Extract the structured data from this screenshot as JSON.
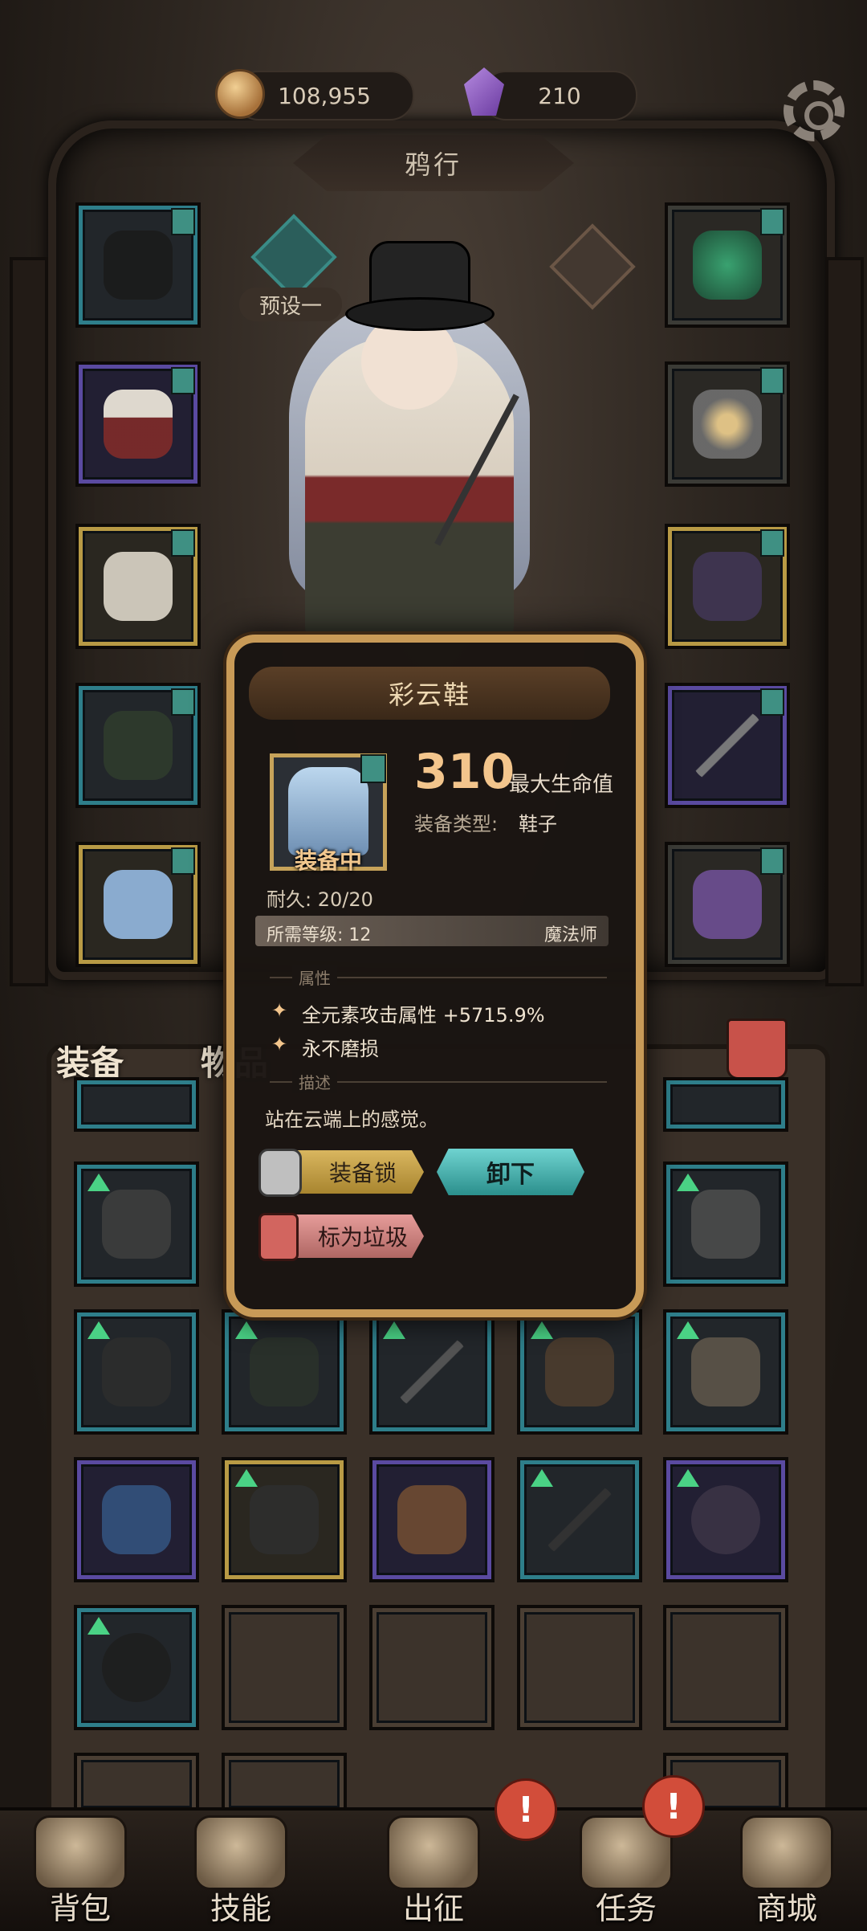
{
  "currency": {
    "gold": "108,955",
    "gems": "210"
  },
  "character": {
    "name": "鸦行",
    "preset_label": "预设一"
  },
  "tabs": {
    "equip": "装备",
    "items": "物品"
  },
  "popup": {
    "title": "彩云鞋",
    "equipped_label": "装备中",
    "stat_value": "310",
    "stat_name": "最大生命值",
    "type_label": "装备类型:",
    "type_value": "鞋子",
    "durability": "耐久: 20/20",
    "req_level": "所需等级: 12",
    "req_class": "魔法师",
    "section_attributes": "属性",
    "attributes": [
      "全元素攻击属性 +5715.9%",
      "永不磨损"
    ],
    "section_description": "描述",
    "description": "站在云端上的感觉。",
    "lock_button": "装备锁",
    "unequip_button": "卸下",
    "trash_button": "标为垃圾"
  },
  "bottom_nav": [
    {
      "label": "背包"
    },
    {
      "label": "技能"
    },
    {
      "label": "出征"
    },
    {
      "label": "任务"
    },
    {
      "label": "商城"
    }
  ],
  "colors": {
    "teal_frame": "#2e7e8a",
    "gold_frame": "#b89a45",
    "purple_frame": "#5a4aa0",
    "popup_border": "#c89a57",
    "accent_value": "#f3c58c",
    "unequip_button": "#2b8f8c"
  }
}
